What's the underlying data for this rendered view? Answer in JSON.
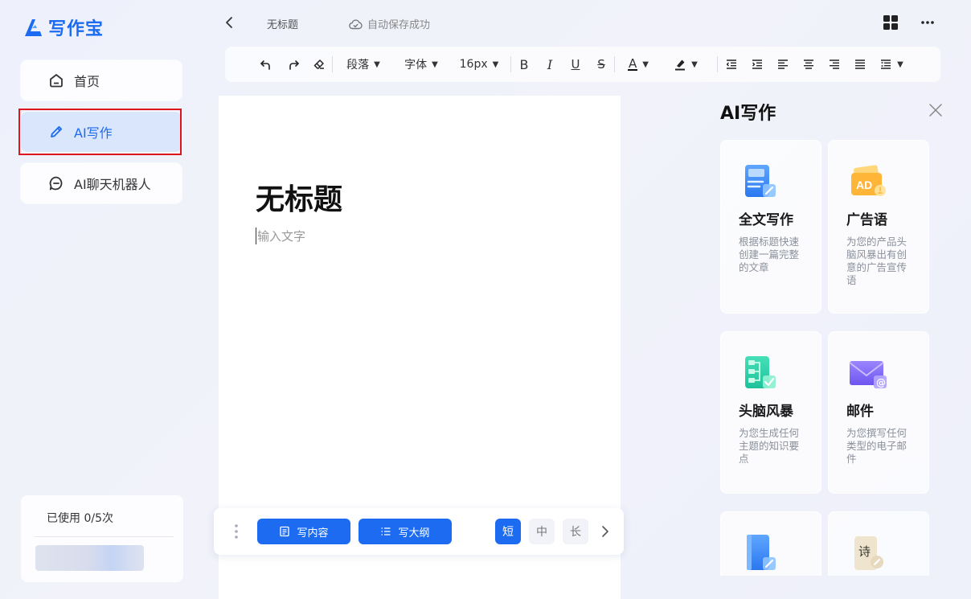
{
  "app": {
    "name": "写作宝",
    "brand_color": "#1c6bf0"
  },
  "sidebar": {
    "items": [
      {
        "label": "首页",
        "icon": "home-icon"
      },
      {
        "label": "AI写作",
        "icon": "pencil-icon",
        "active": true
      },
      {
        "label": "AI聊天机器人",
        "icon": "chat-bot-icon"
      }
    ],
    "usage": "已使用 0/5次"
  },
  "topbar": {
    "doc_title": "无标题",
    "save_status": "自动保存成功"
  },
  "toolbar": {
    "paragraph": "段落",
    "font": "字体",
    "font_size": "16px",
    "bold": "B",
    "italic": "I",
    "underline": "U",
    "strike": "S",
    "font_color": "A"
  },
  "editor": {
    "title": "无标题",
    "placeholder": "输入文字"
  },
  "bottom_bar": {
    "write_content": "写内容",
    "write_outline": "写大纲",
    "lengths": [
      "短",
      "中",
      "长"
    ],
    "selected_length": "短"
  },
  "ai_panel": {
    "title": "AI写作",
    "cards": [
      {
        "name": "全文写作",
        "desc": "根据标题快速创建一篇完整的文章",
        "icon": "document-write-icon"
      },
      {
        "name": "广告语",
        "desc": "为您的产品头脑风暴出有创意的广告宣传语",
        "icon": "ad-icon"
      },
      {
        "name": "头脑风暴",
        "desc": "为您生成任何主题的知识要点",
        "icon": "mindmap-icon"
      },
      {
        "name": "邮件",
        "desc": "为您撰写任何类型的电子邮件",
        "icon": "email-icon"
      },
      {
        "name": "",
        "desc": "",
        "icon": "book-icon"
      },
      {
        "name": "",
        "desc": "",
        "icon": "poem-icon",
        "icon_text": "诗"
      }
    ]
  }
}
